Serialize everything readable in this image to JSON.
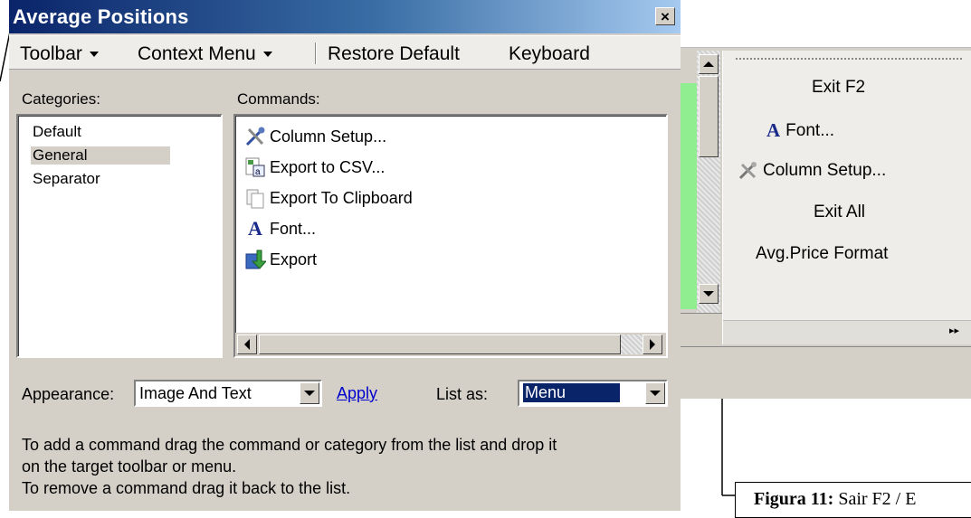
{
  "dialog": {
    "title": "Average Positions",
    "close_label": "×",
    "menu": {
      "toolbar": "Toolbar",
      "context_menu": "Context Menu",
      "restore_default": "Restore Default",
      "keyboard": "Keyboard"
    },
    "categories_label": "Categories:",
    "commands_label": "Commands:",
    "categories": [
      "Default",
      "General",
      "Separator"
    ],
    "selected_category": "General",
    "commands": [
      {
        "label": "Column Setup...",
        "icon": "tools-icon"
      },
      {
        "label": "Export to CSV...",
        "icon": "csv-file-icon"
      },
      {
        "label": "Export To Clipboard",
        "icon": "clipboard-icon"
      },
      {
        "label": "Font...",
        "icon": "font-icon"
      },
      {
        "label": "Export",
        "icon": "export-icon"
      }
    ],
    "appearance_label": "Appearance:",
    "appearance_value": "Image And Text",
    "apply_label": "Apply",
    "list_as_label": "List as:",
    "list_as_value": "Menu",
    "help_line1": "To add a command drag the command or category from the list and drop it",
    "help_line2": "on the target toolbar or menu.",
    "help_line3": "To remove a command drag it back to the list."
  },
  "right_menu": {
    "items": [
      {
        "label": "Exit F2"
      },
      {
        "label": "Font...",
        "icon": "font-icon"
      },
      {
        "label": "Column Setup...",
        "icon": "tools-icon"
      },
      {
        "label": "Exit All"
      },
      {
        "label": "Avg.Price Format"
      }
    ]
  },
  "caption": {
    "bold": "Figura 11:",
    "text": " Sair F2 / E"
  },
  "colors": {
    "title_gradient_start": "#0a246a",
    "title_gradient_end": "#a6caf0",
    "dialog_bg": "#d4d0c8",
    "selection": "#0a246a",
    "link": "#0000cc",
    "grid_green": "#90ee90"
  }
}
